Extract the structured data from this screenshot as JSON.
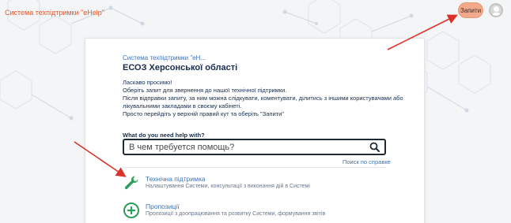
{
  "header": {
    "brand": "Система техпідтримки \"eHelp\"",
    "requests_button": "Запити"
  },
  "portal": {
    "breadcrumb": "Система техпідтримки \"eH...",
    "title": "ЕСОЗ Херсонської області",
    "intro_lines": [
      "Ласкаво просимо!",
      "Оберіть запит для звернення до нашої технічної підтримки.",
      "Після відправки запиту, за ним можна слідкувати, коментувати, ділитись з іншими користувачами або",
      "лікувальними закладами в своєму кабінеті.",
      "Просто перейдіть у верхній правий кут та оберіть \"Запити\""
    ]
  },
  "search": {
    "label": "What do you need help with?",
    "placeholder": "В чем требуется помощь?",
    "link": "Поиск по справке"
  },
  "request_types": [
    {
      "name": "Технічна підтримка",
      "description": "Налаштування Системи, консультації з виконання дій в Системі",
      "icon": "wrench-icon"
    },
    {
      "name": "Пропозиції",
      "description": "Пропозиції з доопрацювання та розвитку Системи, формування звітів",
      "icon": "plus-circle-icon"
    }
  ],
  "colors": {
    "brand": "#e8572a",
    "link": "#3b73b9",
    "requests_button": "#f2a98c",
    "annotation_arrow": "#d9342b",
    "icon_green": "#2e9e5b"
  }
}
